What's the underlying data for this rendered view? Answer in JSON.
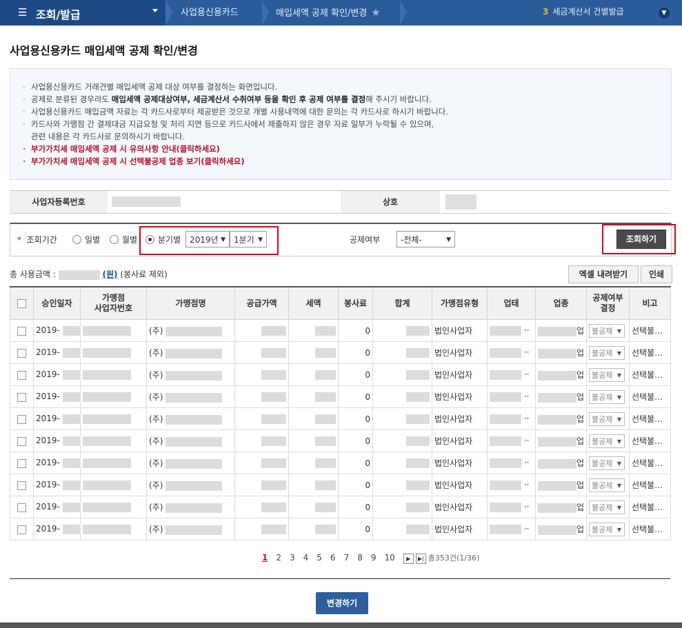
{
  "topbar": {
    "menu_label": "조회/발급",
    "crumbs": [
      "사업용신용카드",
      "매입세액 공제 확인/변경"
    ],
    "right_count": "3",
    "right_text": "세금계산서 건별발급"
  },
  "page_title": "사업용신용카드 매입세액 공제 확인/변경",
  "notice": {
    "line1": "사업용신용카드 거래건별 매입세액 공제 대상 여부를 결정하는 화면입니다.",
    "line2_a": "공제로 분류된 경우라도 ",
    "line2_b": "매입세액 공제대상여부, 세금계산서 수취여부 등을 확인 후 공제 여부를 결정",
    "line2_c": "해 주시기 바랍니다.",
    "line3": "사업용신용카드 매입금액 자료는 각 카드사로부터 제공받은 것으로 개별 사용내역에 대한 문의는 각 카드사로 하시기 바랍니다.",
    "line4": "카드사와 가맹점 간 결제대금 지급요청 및 처리 지연 등으로 카드사에서 제출하지 않은 경우 자료 일부가 누락될 수 있으며,",
    "line5": "관련 내용은 각 카드사로 문의하시기 바랍니다.",
    "link1": "부가가치세 매입세액 공제 시 유의사항 안내(클릭하세요)",
    "link2": "부가가치세 매입세액 공제 시 선택불공제 업종 보기(클릭하세요)"
  },
  "bizinfo": {
    "reg_label": "사업자등록번호",
    "name_label": "상호"
  },
  "search": {
    "period_label": "조회기간",
    "opt_daily": "일별",
    "opt_monthly": "월별",
    "opt_quarterly": "분기별",
    "year": "2019년",
    "quarter": "1분기",
    "deduct_label": "공제여부",
    "deduct_value": "-전체-",
    "search_button": "조회하기"
  },
  "total": {
    "prefix": "총 사용금액 :",
    "unit": "(원)",
    "suffix": "(봉사료 제외)"
  },
  "actions": {
    "excel": "엑셀 내려받기",
    "print": "인쇄"
  },
  "table": {
    "headers": [
      "승인일자",
      "가맹점\n사업자번호",
      "가맹점명",
      "공급가액",
      "세액",
      "봉사료",
      "합계",
      "가맹점유형",
      "업태",
      "업종",
      "공제여부\n결정",
      "비고"
    ],
    "rows": [
      {
        "date": "2019-",
        "merchant_prefix": "(주)",
        "service": "0",
        "type": "법인사업자",
        "industry_suffix": "업",
        "deduct": "불공제",
        "note": "선택불…"
      },
      {
        "date": "2019-",
        "merchant_prefix": "(주)",
        "service": "0",
        "type": "법인사업자",
        "industry_suffix": "업",
        "deduct": "불공제",
        "note": "선택불…"
      },
      {
        "date": "2019-",
        "merchant_prefix": "(주)",
        "service": "0",
        "type": "법인사업자",
        "industry_suffix": "업",
        "deduct": "불공제",
        "note": "선택불…"
      },
      {
        "date": "2019-",
        "merchant_prefix": "(주)",
        "service": "0",
        "type": "법인사업자",
        "industry_suffix": "업",
        "deduct": "불공제",
        "note": "선택불…"
      },
      {
        "date": "2019-",
        "merchant_prefix": "(주)",
        "service": "0",
        "type": "법인사업자",
        "industry_suffix": "업",
        "deduct": "불공제",
        "note": "선택불…"
      },
      {
        "date": "2019-",
        "merchant_prefix": "(주)",
        "service": "0",
        "type": "법인사업자",
        "industry_suffix": "업",
        "deduct": "불공제",
        "note": "선택불…"
      },
      {
        "date": "2019-",
        "merchant_prefix": "(주)",
        "service": "0",
        "type": "법인사업자",
        "industry_suffix": "업",
        "deduct": "불공제",
        "note": "선택불…"
      },
      {
        "date": "2019-",
        "merchant_prefix": "(주)",
        "service": "0",
        "type": "법인사업자",
        "industry_suffix": "업",
        "deduct": "불공제",
        "note": "선택불…"
      },
      {
        "date": "2019-",
        "merchant_prefix": "(주)",
        "service": "0",
        "type": "법인사업자",
        "industry_suffix": "업",
        "deduct": "불공제",
        "note": "선택불…"
      },
      {
        "date": "2019-",
        "merchant_prefix": "(주)",
        "service": "0",
        "type": "법인사업자",
        "industry_suffix": "업",
        "deduct": "불공제",
        "note": "선택불…"
      }
    ]
  },
  "pager": {
    "pages": [
      "1",
      "2",
      "3",
      "4",
      "5",
      "6",
      "7",
      "8",
      "9",
      "10"
    ],
    "summary": "총353건(1/36)"
  },
  "change_button": "변경하기"
}
